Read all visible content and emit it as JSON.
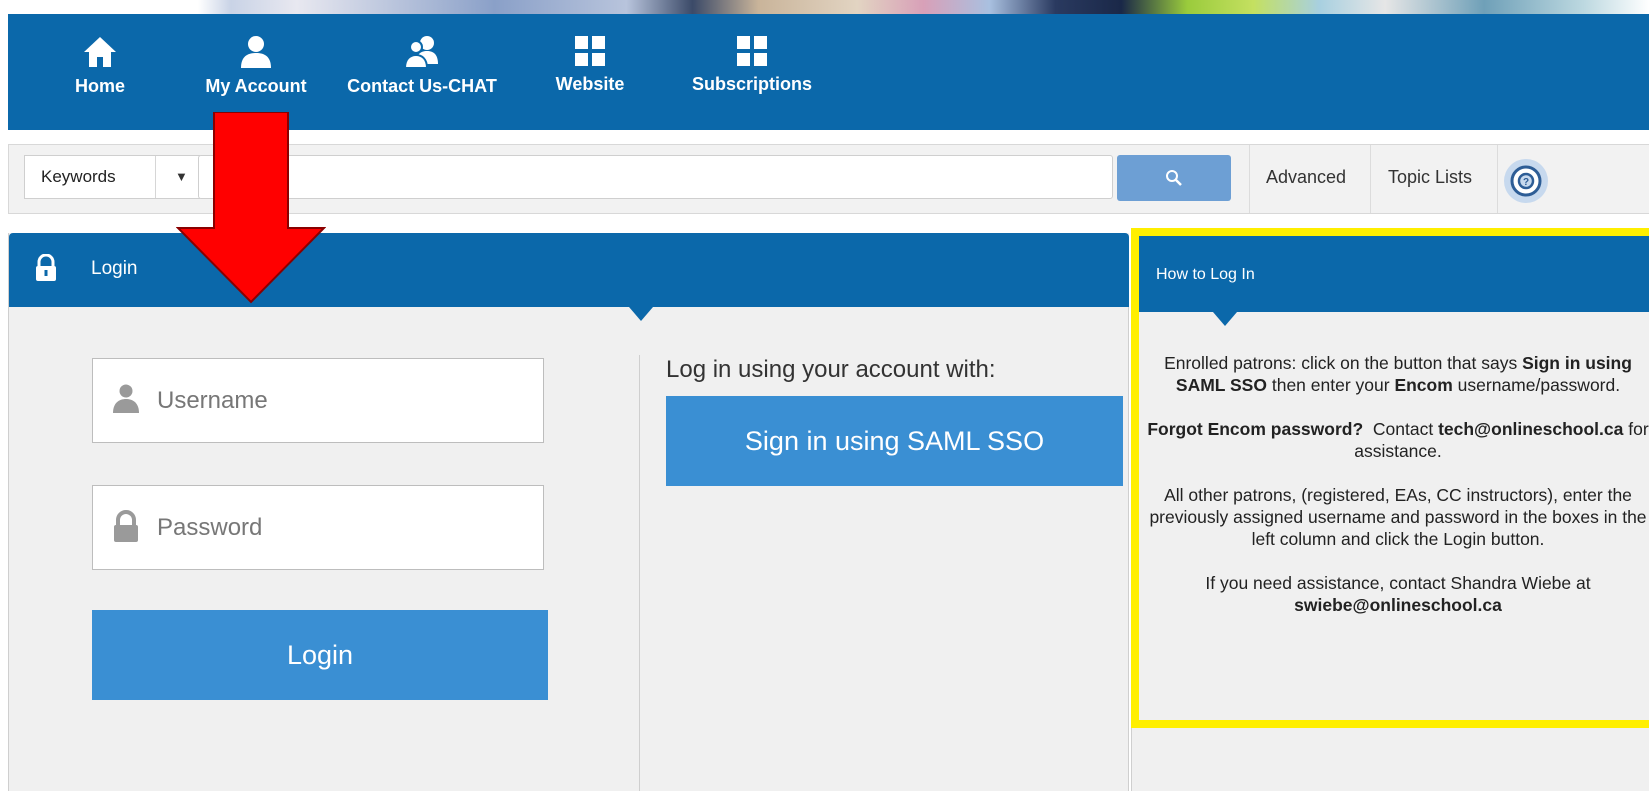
{
  "nav": {
    "items": [
      {
        "label": "Home",
        "icon": "home-icon"
      },
      {
        "label": "My Account",
        "icon": "user-icon"
      },
      {
        "label": "Contact Us-CHAT",
        "icon": "users-icon"
      },
      {
        "label": "Website",
        "icon": "grid-icon"
      },
      {
        "label": "Subscriptions",
        "icon": "grid-icon"
      }
    ]
  },
  "search": {
    "type_value": "Keywords",
    "placeholder": "",
    "advanced_label": "Advanced",
    "topic_lists_label": "Topic Lists"
  },
  "login": {
    "title": "Login",
    "username_placeholder": "Username",
    "password_placeholder": "Password",
    "login_button": "Login",
    "sso_heading": "Log in using your account with:",
    "sso_button": "Sign in using SAML SSO"
  },
  "howto": {
    "title": "How to Log In",
    "p1_a": "Enrolled patrons: click on the button that says ",
    "p1_b": "Sign in using SAML SSO",
    "p1_c": " then enter your ",
    "p1_d": "Encom",
    "p1_e": " username/password.",
    "p2_a": "Forgot Encom password?",
    "p2_b": "  Contact ",
    "p2_c": "tech@onlineschool.ca",
    "p2_d": " for assistance.",
    "p3": "All other patrons, (registered, EAs, CC instructors), enter the previously assigned username and password in the boxes in the left column and click the Login button.",
    "p4_a": "If you need assistance, contact Shandra Wiebe at ",
    "p4_b": "swiebe@onlineschool.ca"
  },
  "colors": {
    "nav_blue": "#0b68aa",
    "button_blue": "#3a8fd3",
    "highlight_yellow": "#ffef00",
    "annotation_red": "#ff0000"
  }
}
